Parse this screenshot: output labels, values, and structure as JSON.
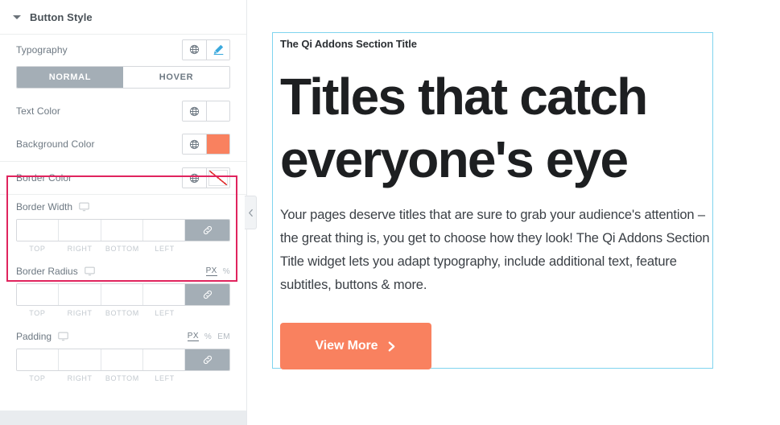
{
  "panel": {
    "title": "Button Style",
    "caret_icon": "caret-down-icon",
    "rows": {
      "typography": {
        "label": "Typography",
        "globe_icon": "globe-icon",
        "edit_icon": "pencil-edit-icon"
      },
      "state_tabs": [
        {
          "label": "NORMAL",
          "active": true
        },
        {
          "label": "HOVER",
          "active": false
        }
      ],
      "text_color": {
        "label": "Text Color",
        "globe_icon": "globe-icon",
        "swatch_icon": "color-swatch-empty",
        "swatch_color": "#ffffff"
      },
      "background_color": {
        "label": "Background Color",
        "globe_icon": "globe-icon",
        "swatch_icon": "color-swatch",
        "swatch_color": "#f9815f"
      },
      "border_color": {
        "label": "Border Color",
        "globe_icon": "globe-icon",
        "swatch_icon": "color-swatch-none",
        "swatch_color": "none"
      },
      "border_width": {
        "label": "Border Width",
        "device_icon": "desktop-monitor-icon",
        "values": [
          "",
          "",
          "",
          ""
        ],
        "side_labels": [
          "TOP",
          "RIGHT",
          "BOTTOM",
          "LEFT"
        ],
        "link_icon": "link-chain-icon",
        "units": []
      },
      "border_radius": {
        "label": "Border Radius",
        "device_icon": "desktop-monitor-icon",
        "values": [
          "",
          "",
          "",
          ""
        ],
        "side_labels": [
          "TOP",
          "RIGHT",
          "BOTTOM",
          "LEFT"
        ],
        "link_icon": "link-chain-icon",
        "units": [
          {
            "label": "PX",
            "active": true
          },
          {
            "label": "%",
            "active": false
          }
        ]
      },
      "padding": {
        "label": "Padding",
        "device_icon": "desktop-monitor-icon",
        "values": [
          "",
          "",
          "",
          ""
        ],
        "side_labels": [
          "TOP",
          "RIGHT",
          "BOTTOM",
          "LEFT"
        ],
        "link_icon": "link-chain-icon",
        "units": [
          {
            "label": "PX",
            "active": true
          },
          {
            "label": "%",
            "active": false
          },
          {
            "label": "EM",
            "active": false
          }
        ]
      }
    },
    "highlight_color": "#e0245e"
  },
  "collapse_handle": {
    "icon": "chevron-left-icon"
  },
  "preview": {
    "eyebrow": "The Qi Addons Section Title",
    "title": "Titles that catch everyone's eye",
    "body": "Your pages deserve titles that are sure to grab your audience's attention – the great thing is, you get to choose how they look! The Qi Addons Section Title widget lets you adapt typography, include additional text, feature subtitles, buttons & more.",
    "cta": {
      "label": "View More",
      "icon": "chevron-right-icon",
      "color": "#f9815f"
    },
    "outline_color": "#7fd4ef"
  }
}
